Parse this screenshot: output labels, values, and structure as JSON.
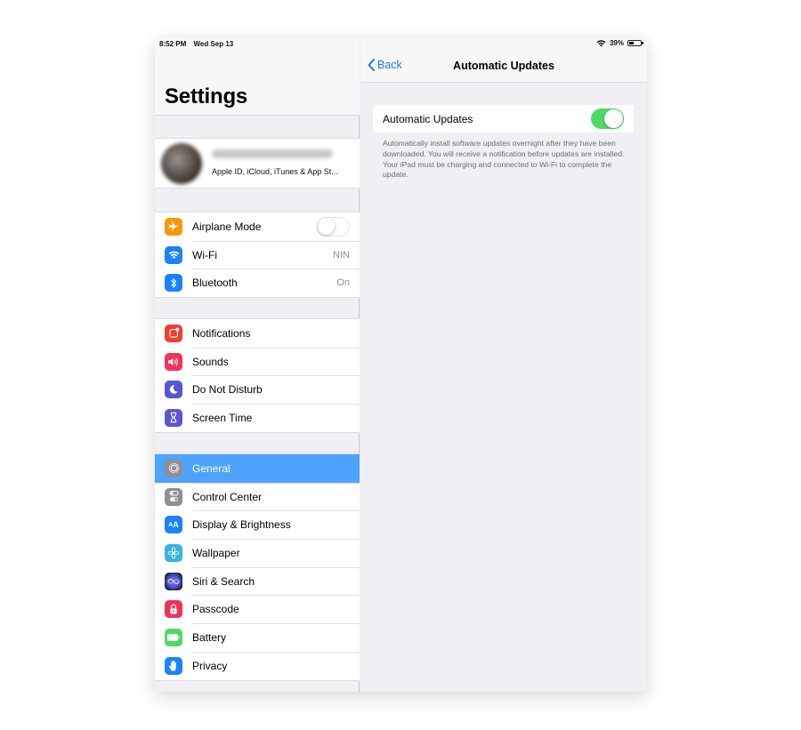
{
  "status_bar": {
    "time": "8:52 PM",
    "date": "Wed Sep 13",
    "battery_percent_label": "39%",
    "battery_level": 0.39,
    "wifi_icon": "wifi-icon"
  },
  "master": {
    "title": "Settings",
    "profile": {
      "name": "(blurred)",
      "subtitle": "Apple ID, iCloud, iTunes & App St..."
    },
    "groups": [
      {
        "items": [
          {
            "label": "Airplane Mode",
            "icon": "airplane-icon",
            "color": "#ff9500",
            "toggle": false
          },
          {
            "label": "Wi-Fi",
            "icon": "wifi-icon",
            "color": "#1a82fb",
            "value": "NIN"
          },
          {
            "label": "Bluetooth",
            "icon": "bluetooth-icon",
            "color": "#1a82fb",
            "value": "On"
          }
        ]
      },
      {
        "items": [
          {
            "label": "Notifications",
            "icon": "notifications-icon",
            "color": "#f23d30"
          },
          {
            "label": "Sounds",
            "icon": "sounds-icon",
            "color": "#f2325a"
          },
          {
            "label": "Do Not Disturb",
            "icon": "moon-icon",
            "color": "#5a55d0"
          },
          {
            "label": "Screen Time",
            "icon": "hourglass-icon",
            "color": "#5a55d0"
          }
        ]
      },
      {
        "items": [
          {
            "label": "General",
            "icon": "gear-icon",
            "color": "#8e8e93",
            "selected": true
          },
          {
            "label": "Control Center",
            "icon": "switches-icon",
            "color": "#8e8e93"
          },
          {
            "label": "Display & Brightness",
            "icon": "text-size-icon",
            "color": "#1a82fb"
          },
          {
            "label": "Wallpaper",
            "icon": "flower-icon",
            "color": "#35b5e0"
          },
          {
            "label": "Siri & Search",
            "icon": "siri-icon",
            "color": "#222233"
          },
          {
            "label": "Passcode",
            "icon": "lock-icon",
            "color": "#f2325a"
          },
          {
            "label": "Battery",
            "icon": "battery-icon",
            "color": "#4cd964"
          },
          {
            "label": "Privacy",
            "icon": "hand-icon",
            "color": "#1a82fb"
          }
        ]
      }
    ]
  },
  "detail": {
    "back_label": "Back",
    "title": "Automatic Updates",
    "setting": {
      "label": "Automatic Updates",
      "enabled": true
    },
    "footer": "Automatically install software updates overnight after they have been downloaded. You will receive a notification before updates are installed. Your iPad must be charging and connected to Wi-Fi to complete the update."
  },
  "colors": {
    "accent": "#1a7cf5",
    "selection": "#4da3ff",
    "toggle_on": "#4cd964",
    "background": "#efeff4"
  }
}
